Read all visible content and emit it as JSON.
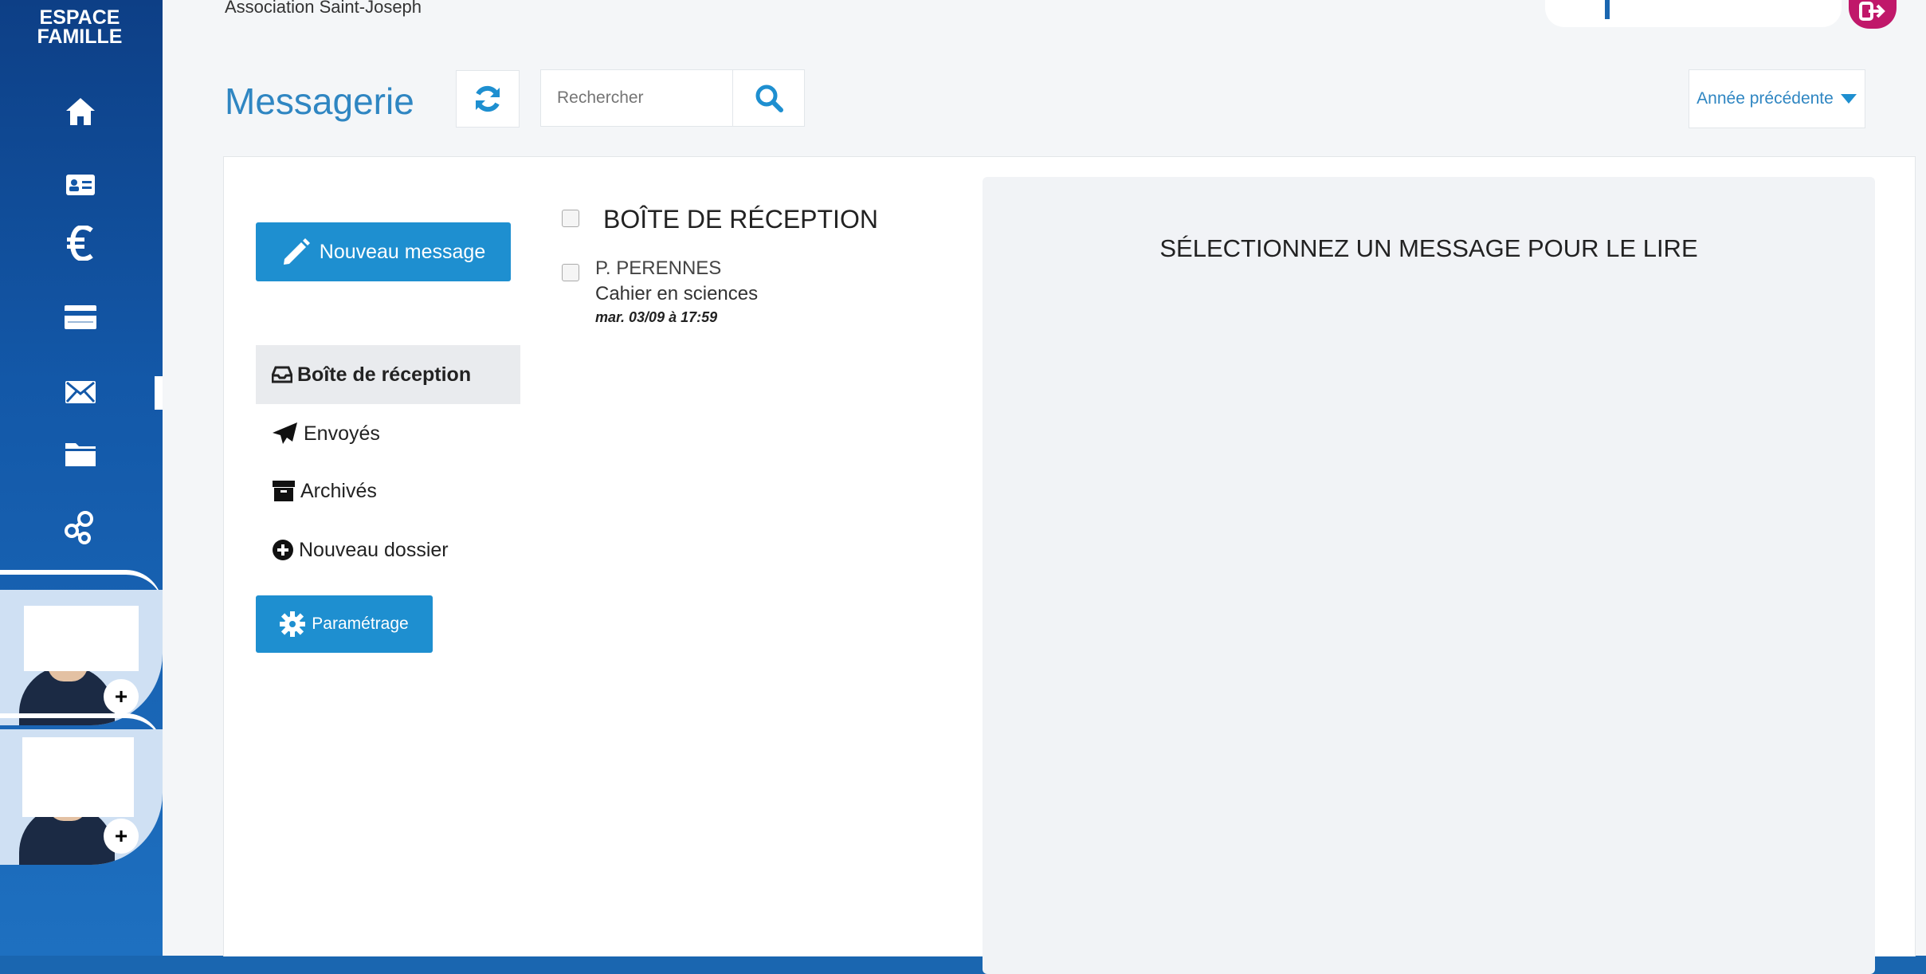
{
  "brand": {
    "line1": "ESPACE",
    "line2": "FAMILLE"
  },
  "sidebar": {
    "items": [
      {
        "icon": "home-icon"
      },
      {
        "icon": "id-card-icon"
      },
      {
        "icon": "euro-icon"
      },
      {
        "icon": "card-icon"
      },
      {
        "icon": "mail-icon",
        "active": true
      },
      {
        "icon": "folder-icon"
      },
      {
        "icon": "network-icon"
      }
    ]
  },
  "header": {
    "org_name": "Association Saint-Joseph"
  },
  "page": {
    "title": "Messagerie"
  },
  "search": {
    "placeholder": "Rechercher"
  },
  "year": {
    "label": "Année précédente"
  },
  "actions": {
    "new_message": "Nouveau message",
    "settings": "Paramétrage"
  },
  "folders": [
    {
      "label": "Boîte de réception",
      "icon": "inbox-icon",
      "active": true
    },
    {
      "label": "Envoyés",
      "icon": "paper-plane-icon"
    },
    {
      "label": "Archivés",
      "icon": "archive-icon"
    },
    {
      "label": "Nouveau dossier",
      "icon": "plus-circle-icon"
    }
  ],
  "inbox": {
    "title": "BOÎTE DE RÉCEPTION",
    "messages": [
      {
        "sender": "P. PERENNES",
        "subject": "Cahier en sciences",
        "date": "mar. 03/09 à 17:59"
      }
    ]
  },
  "reader": {
    "placeholder": "SÉLECTIONNEZ UN MESSAGE POUR LE LIRE"
  },
  "colors": {
    "accent": "#1e8fd0",
    "title": "#2f86c2",
    "sidebar": "#1358a8",
    "logout": "#c0186a"
  }
}
